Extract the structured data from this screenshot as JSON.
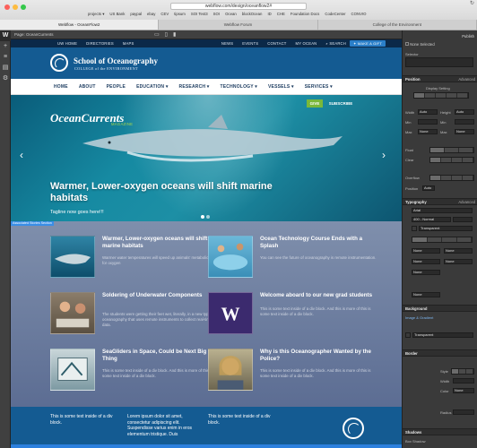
{
  "browser": {
    "url": "webflow.com/design/oceanflow2#",
    "bookmarks": [
      "projects ▾",
      "US Bank",
      "paypal",
      "ebay",
      "CEV",
      "tipsum",
      "SOI Test3",
      "SOI",
      "Ocean",
      "blockOcean",
      "ID",
      "CHE",
      "Foundation Docs",
      "CodeCenter",
      "CONVIO"
    ],
    "tabs": [
      {
        "label": "Webflow - OceanFlow2",
        "active": true
      },
      {
        "label": "Webflow Forum",
        "active": false
      },
      {
        "label": "College of the Environment",
        "active": false
      }
    ]
  },
  "editor": {
    "page_label": "Page: OceanCurrents",
    "left_icons": [
      "webflow-logo",
      "add",
      "navigator",
      "pages",
      "settings"
    ],
    "top_icons": [
      "desktop",
      "tablet",
      "phone",
      "preview",
      "undo"
    ]
  },
  "site": {
    "utility_left": [
      "UW HOME",
      "DIRECTORIES",
      "MAPS"
    ],
    "utility_right": [
      "NEWS",
      "EVENTS",
      "CONTACT",
      "MY OCEAN"
    ],
    "search_label": "SEARCH",
    "make_gift": "✦ MAKE A GIFT",
    "school_name": "School of Oceanography",
    "college_name": "COLLEGE of the ENVIRONMENT",
    "nav": [
      "HOME",
      "ABOUT",
      "PEOPLE",
      "EDUCATION ▾",
      "RESEARCH ▾",
      "TECHNOLOGY ▾",
      "VESSELS ▾",
      "SERVICES ▾"
    ],
    "hero": {
      "title": "OceanCurrents",
      "magazine": "MAGAZINE",
      "give": "GIVE",
      "subscribe": "SUBSCRIBE",
      "headline": "Warmer, Lower-oxygen oceans will shift marine habitats",
      "tagline": "Tagline now goes here!!!"
    },
    "selector_tag": "Associated Stories Section",
    "cards": [
      {
        "title": "Warmer, Lower-oxygen oceans will shift marine habitats",
        "body": "Warmer water temperatures will speed up animals' metabolic need for oxygen",
        "thumb": "shark"
      },
      {
        "title": "Ocean Technology Course Ends with a Splash",
        "body": "You can see the future of oceanography is remote instrumentation.",
        "thumb": "pool"
      },
      {
        "title": "Soldering of Underwater Components",
        "body": "The students were getting their feet wet, literally, in a new type of oceanography that uses remote instruments to collect real-time data.",
        "thumb": "lab"
      },
      {
        "title": "Welcome aboard to our new grad students",
        "body": "This is some text inside of a div block. And this is more of this is some text inside of a div block.",
        "thumb": "w-logo"
      },
      {
        "title": "SeaGliders in Space, Could be Next Big Thing",
        "body": "This is some text inside of a div block. And this is more of this is some text inside of a div block.",
        "thumb": "glider"
      },
      {
        "title": "Why is this Oceanographer Wanted by the Police?",
        "body": "This is some text inside of a div block. And this is more of this is some text inside of a div block.",
        "thumb": "person"
      }
    ],
    "footer": {
      "col1": "This is some text inside of a div block.",
      "col2": "Lorem ipsum dolor sit amet, consectetur adipiscing elit. Suspendisse varius enim in eros elementum tristique. Duis",
      "col3": "This is some text inside of a div block."
    }
  },
  "panel": {
    "none_selected": "None Selected",
    "selector_label": "Selector",
    "position": "Position",
    "advanced": "Advanced",
    "display_setting": "Display Setting",
    "width": "Width",
    "height": "Height",
    "min": "Min",
    "max": "Max",
    "auto": "Auto",
    "float": "Float",
    "clear": "Clear",
    "overflow": "Overflow",
    "typography": "Typography",
    "font": "Arial",
    "font_weight": "400 - Normal",
    "text_color": "Transparent",
    "none": "None",
    "background": "Background",
    "image_gradient": "Image & Gradient",
    "bg_color": "Transparent",
    "border": "Border",
    "style": "Style",
    "width2": "Width",
    "color": "Color",
    "shadows": "Shadows",
    "radius": "Radius",
    "box_shadow": "Box Shadow",
    "publish": "Publish"
  },
  "colors": {
    "utility_bar": "#0b2948",
    "brand_bar": "#145b92",
    "give_green": "#7ab83a",
    "selection_blue": "#3a8ee6"
  }
}
